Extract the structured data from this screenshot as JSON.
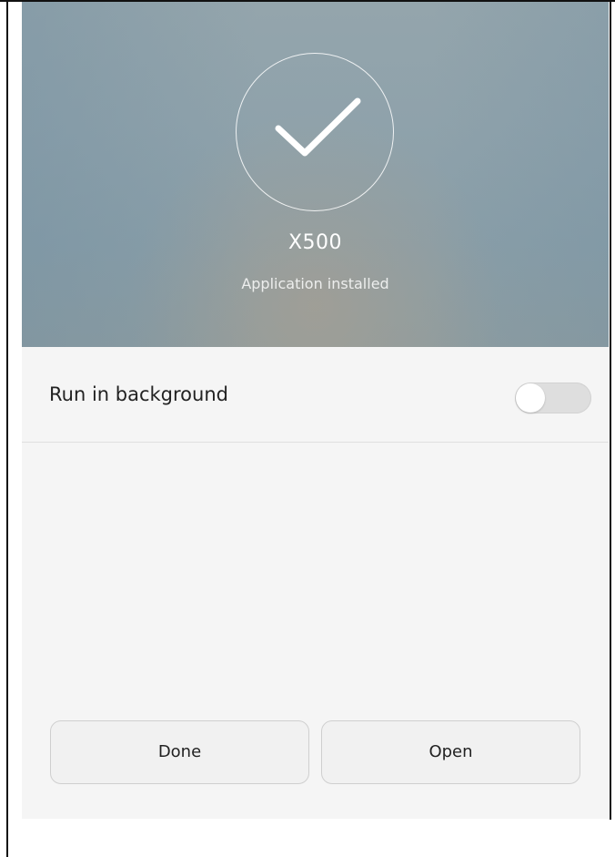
{
  "install_screen": {
    "app_name": "X500",
    "status": "Application installed",
    "check_icon": "checkmark-icon"
  },
  "settings": {
    "run_in_background": {
      "label": "Run in background",
      "enabled": false
    }
  },
  "actions": {
    "done_label": "Done",
    "open_label": "Open"
  },
  "colors": {
    "hero_top": "#94a5ac",
    "hero_bottom": "#8c9ca1",
    "panel_background": "#f5f5f5",
    "toggle_off": "#dedede",
    "button_background": "#f1f1f1"
  }
}
